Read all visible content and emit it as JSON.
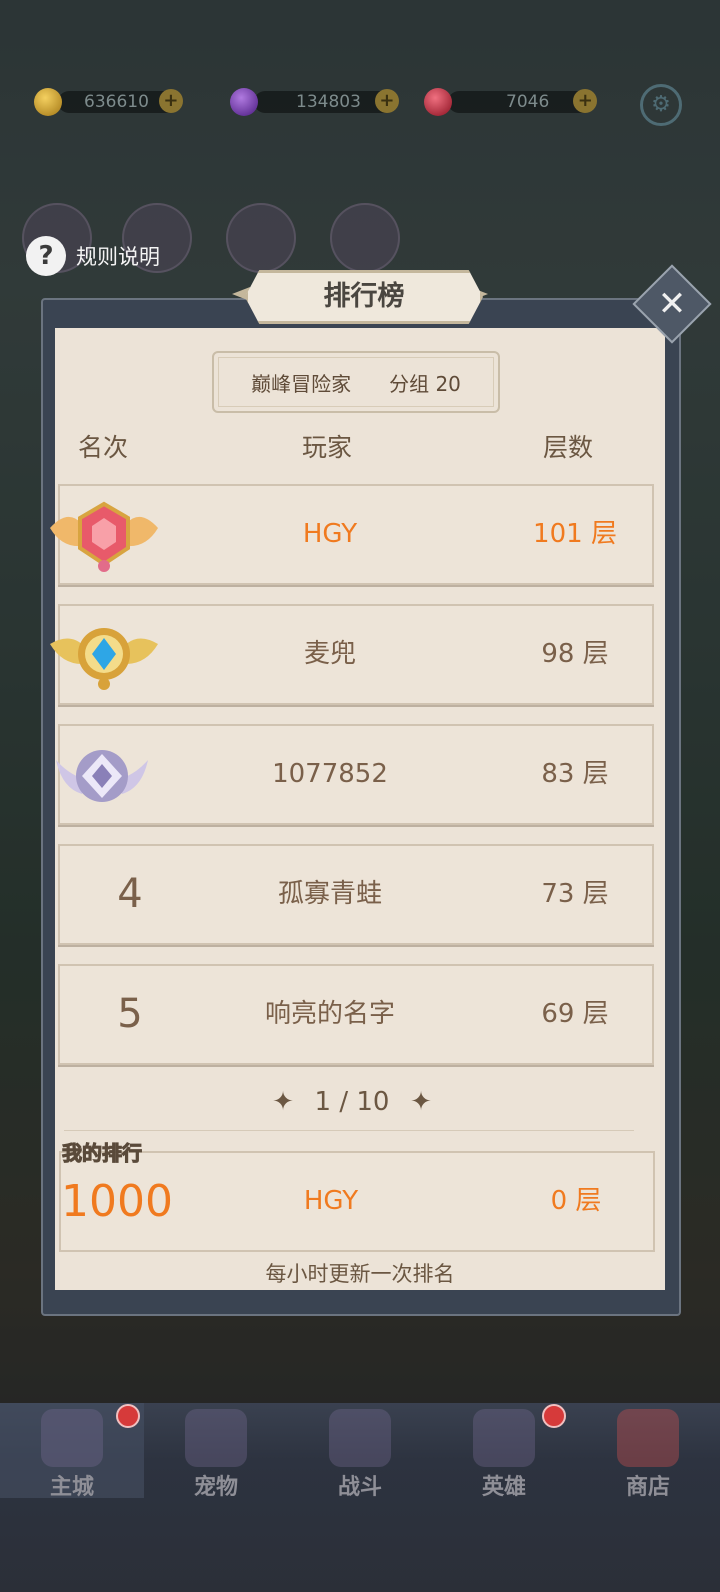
{
  "resources": [
    {
      "icon": "gold-coin-icon",
      "value": "636610",
      "color": "#d1a12a"
    },
    {
      "icon": "purple-gem-icon",
      "value": "134803",
      "color": "#7b3ac0"
    },
    {
      "icon": "red-gem-icon",
      "value": "7046",
      "color": "#c0283a"
    }
  ],
  "rules_label": "规则说明",
  "panel": {
    "title": "排行榜",
    "group_name": "巅峰冒险家",
    "group_number": "分组 20",
    "headers": {
      "rank": "名次",
      "player": "玩家",
      "floors": "层数"
    },
    "rows": [
      {
        "rank": "1",
        "medal": "ruby-medal-icon",
        "player": "HGY",
        "floors": "101 层",
        "highlight": true
      },
      {
        "rank": "2",
        "medal": "gold-medal-icon",
        "player": "麦兜",
        "floors": "98 层",
        "highlight": false
      },
      {
        "rank": "3",
        "medal": "silver-medal-icon",
        "player": "1077852",
        "floors": "83 层",
        "highlight": false
      },
      {
        "rank": "4",
        "player": "孤寡青蛙",
        "floors": "73 层",
        "highlight": false
      },
      {
        "rank": "5",
        "player": "响亮的名字",
        "floors": "69 层",
        "highlight": false
      }
    ],
    "pager": "1 / 10",
    "my_rank_label": "我的排行",
    "my_rank": {
      "rank": "1000",
      "player": "HGY",
      "floors": "0 层"
    },
    "update_note": "每小时更新一次排名"
  },
  "nav": [
    {
      "label": "主城",
      "active": true,
      "badge": true
    },
    {
      "label": "宠物",
      "active": false,
      "badge": false
    },
    {
      "label": "战斗",
      "active": false,
      "badge": false
    },
    {
      "label": "英雄",
      "active": false,
      "badge": true
    },
    {
      "label": "商店",
      "active": false,
      "badge": false
    }
  ],
  "colors": {
    "accent_orange": "#f07a1f",
    "text_brown": "#7a604a"
  }
}
